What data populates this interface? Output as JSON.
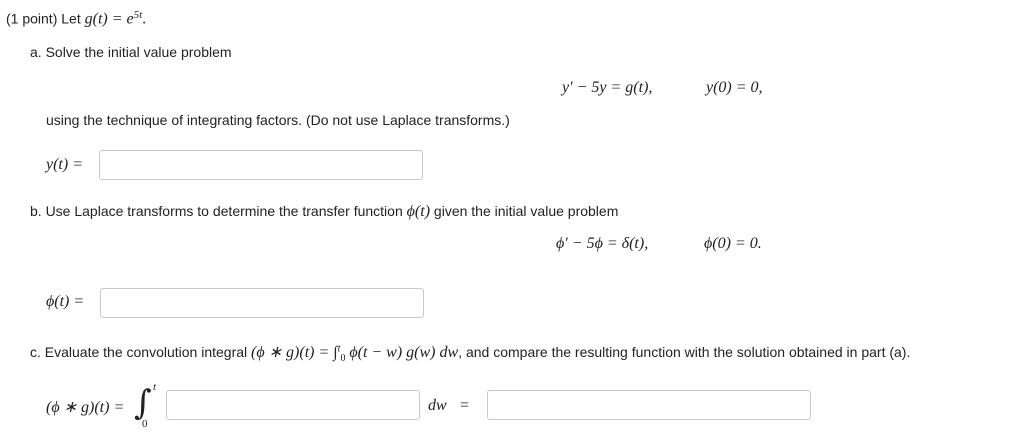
{
  "header": {
    "points": "(1 point) Let",
    "g_def": "g(t) = e",
    "g_exp": "5t",
    "g_end": "."
  },
  "part_a": {
    "label": "a. Solve the initial value problem",
    "ode": "y′ − 5y = g(t),",
    "ic": "y(0) = 0,",
    "method": "using the technique of integrating factors. (Do not use Laplace transforms.)",
    "answer_label": "y(t) =",
    "answer_value": ""
  },
  "part_b": {
    "label_pre": "b. Use Laplace transforms to determine the transfer function",
    "label_math": "ϕ(t)",
    "label_post": "given the initial value problem",
    "ode": "ϕ′ − 5ϕ = δ(t),",
    "ic": "ϕ(0) = 0.",
    "answer_label": "ϕ(t) =",
    "answer_value": ""
  },
  "part_c": {
    "label_pre": "c. Evaluate the convolution integral",
    "conv_math": "(ϕ ∗ g)(t) = ∫",
    "upper_small": "t",
    "lower_small": "0",
    "integrand": "ϕ(t − w) g(w) dw",
    "label_post": ", and compare the resulting function with the solution obtained in part (a).",
    "lhs": "(ϕ ∗ g)(t) =",
    "integral_symbol": "∫",
    "upper_limit": "t",
    "lower_limit": "0",
    "integrand_value": "",
    "dw": "dw",
    "equals": "=",
    "result_value": ""
  }
}
